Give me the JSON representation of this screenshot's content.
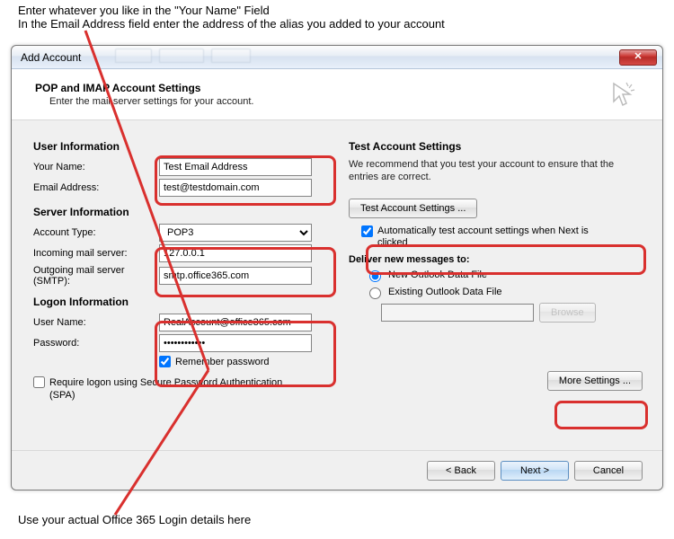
{
  "instructions": {
    "top_line1": "Enter whatever you like in the \"Your Name\" Field",
    "top_line2": "In the Email Address field enter the address of the alias you added to your account",
    "bottom": "Use your actual Office 365 Login details here"
  },
  "dialog": {
    "title": "Add Account",
    "close_icon": "✕",
    "header_title": "POP and IMAP Account Settings",
    "header_sub": "Enter the mail server settings for your account."
  },
  "left": {
    "user_info_title": "User Information",
    "your_name_label": "Your Name:",
    "your_name_value": "Test Email Address",
    "email_label": "Email Address:",
    "email_value": "test@testdomain.com",
    "server_info_title": "Server Information",
    "account_type_label": "Account Type:",
    "account_type_value": "POP3",
    "incoming_label": "Incoming mail server:",
    "incoming_value": "127.0.0.1",
    "outgoing_label": "Outgoing mail server (SMTP):",
    "outgoing_value": "smtp.office365.com",
    "logon_title": "Logon Information",
    "username_label": "User Name:",
    "username_value": "RealAccount@office365.com",
    "password_label": "Password:",
    "password_value": "************",
    "remember_label": "Remember password",
    "spa_label": "Require logon using Secure Password Authentication (SPA)"
  },
  "right": {
    "test_title": "Test Account Settings",
    "test_desc": "We recommend that you test your account to ensure that the entries are correct.",
    "test_btn": "Test Account Settings ...",
    "auto_test_label": "Automatically test account settings when Next is clicked",
    "deliver_title": "Deliver new messages to:",
    "new_file_label": "New Outlook Data File",
    "existing_file_label": "Existing Outlook Data File",
    "browse_btn": "Browse",
    "more_btn": "More Settings ..."
  },
  "footer": {
    "back": "< Back",
    "next": "Next >",
    "cancel": "Cancel"
  }
}
